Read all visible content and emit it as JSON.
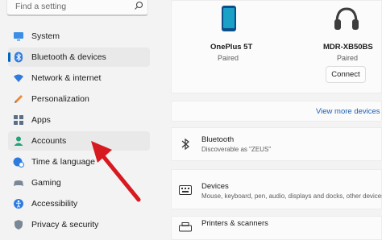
{
  "search": {
    "placeholder": "Find a setting"
  },
  "sidebar": {
    "items": [
      {
        "label": "System",
        "icon": "monitor-icon"
      },
      {
        "label": "Bluetooth & devices",
        "icon": "bluetooth-icon"
      },
      {
        "label": "Network & internet",
        "icon": "wifi-icon"
      },
      {
        "label": "Personalization",
        "icon": "pencil-icon"
      },
      {
        "label": "Apps",
        "icon": "apps-icon"
      },
      {
        "label": "Accounts",
        "icon": "person-icon"
      },
      {
        "label": "Time & language",
        "icon": "globe-clock-icon"
      },
      {
        "label": "Gaming",
        "icon": "controller-icon"
      },
      {
        "label": "Accessibility",
        "icon": "accessibility-icon"
      },
      {
        "label": "Privacy & security",
        "icon": "shield-icon"
      }
    ]
  },
  "devices": {
    "phone": {
      "name": "OnePlus 5T",
      "status": "Paired",
      "icon": "phone-icon"
    },
    "headphones": {
      "name": "MDR-XB50BS",
      "status": "Paired",
      "icon": "headphones-icon",
      "button": "Connect"
    },
    "view_more": "View more devices"
  },
  "bluetooth_row": {
    "title": "Bluetooth",
    "subtitle": "Discoverable as \"ZEUS\"",
    "icon": "bluetooth-icon"
  },
  "devices_row": {
    "title": "Devices",
    "subtitle": "Mouse, keyboard, pen, audio, displays and docks, other devices",
    "icon": "keyboard-icon"
  },
  "printers_row": {
    "title": "Printers & scanners",
    "icon": "printer-icon"
  },
  "colors": {
    "accent": "#0067c0",
    "arrow": "#d71920",
    "link": "#1a5fb4"
  }
}
